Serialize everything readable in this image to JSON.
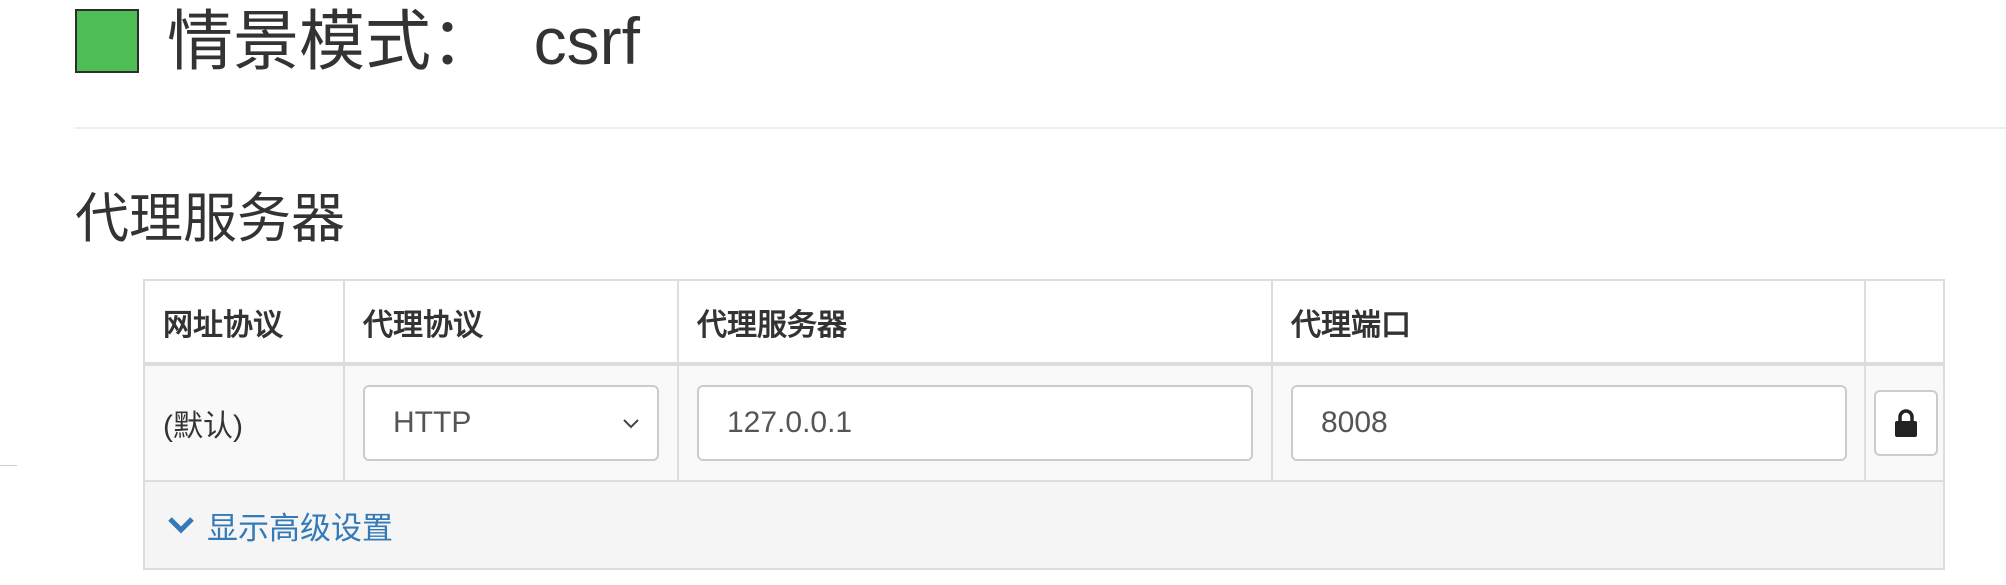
{
  "header": {
    "title": "情景模式：  csrf",
    "swatch_color": "#4fbd55"
  },
  "section": {
    "title": "代理服务器"
  },
  "table": {
    "columns": [
      "网址协议",
      "代理协议",
      "代理服务器",
      "代理端口",
      ""
    ],
    "row": {
      "scheme": "(默认)",
      "protocol": "HTTP",
      "server": "127.0.0.1",
      "port": "8008"
    }
  },
  "advanced": {
    "label": "显示高级设置",
    "icon": "chevron-down-icon"
  },
  "colors": {
    "accent": "#337ab7",
    "border": "#dddddd"
  }
}
